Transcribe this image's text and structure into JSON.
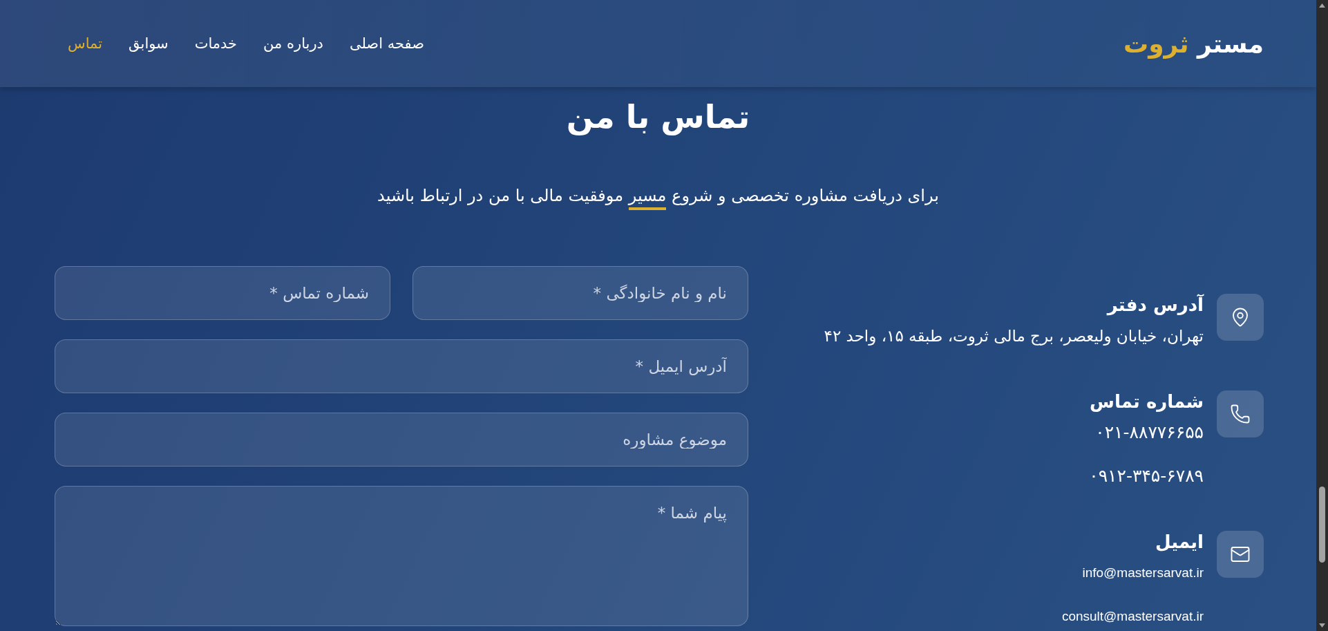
{
  "header": {
    "logo": {
      "text": "مستر",
      "accent": "ثروت"
    },
    "nav": [
      {
        "label": "صفحه اصلی",
        "selected": false
      },
      {
        "label": "درباره من",
        "selected": false
      },
      {
        "label": "خدمات",
        "selected": false
      },
      {
        "label": "سوابق",
        "selected": false
      },
      {
        "label": "تماس",
        "selected": true
      }
    ]
  },
  "hero": {
    "title": "تماس با من",
    "subtitle": [
      {
        "text": "برای دریافت مشاوره تخصصی و شروع",
        "highlight": false
      },
      {
        "text": "مسیر",
        "highlight": true
      },
      {
        "text": "موفقیت مالی با من در ارتباط باشید",
        "highlight": false
      }
    ]
  },
  "contact_info": [
    {
      "kind": "address",
      "heading": "آدرس دفتر",
      "lines": [
        "تهران، خیابان ولیعصر، برج مالی ثروت، طبقه ۱۵، واحد ۴۲"
      ]
    },
    {
      "kind": "phone",
      "heading": "شماره تماس",
      "lines": [
        "۰۲۱-۸۸۷۷۶۶۵۵",
        "۰۹۱۲-۳۴۵-۶۷۸۹"
      ]
    },
    {
      "kind": "email",
      "heading": "ایمیل",
      "lines": [
        "info@mastersarvat.ir",
        "consult@mastersarvat.ir"
      ]
    }
  ],
  "form": {
    "rows": [
      [
        {
          "kind": "input",
          "placeholder": "نام و نام خانوادگی *"
        },
        {
          "kind": "input",
          "placeholder": "شماره تماس *"
        }
      ],
      [
        {
          "kind": "input",
          "placeholder": "آدرس ایمیل *"
        }
      ],
      [
        {
          "kind": "input",
          "placeholder": "موضوع مشاوره"
        }
      ],
      [
        {
          "kind": "textarea",
          "placeholder": "پیام شما *"
        }
      ]
    ]
  }
}
